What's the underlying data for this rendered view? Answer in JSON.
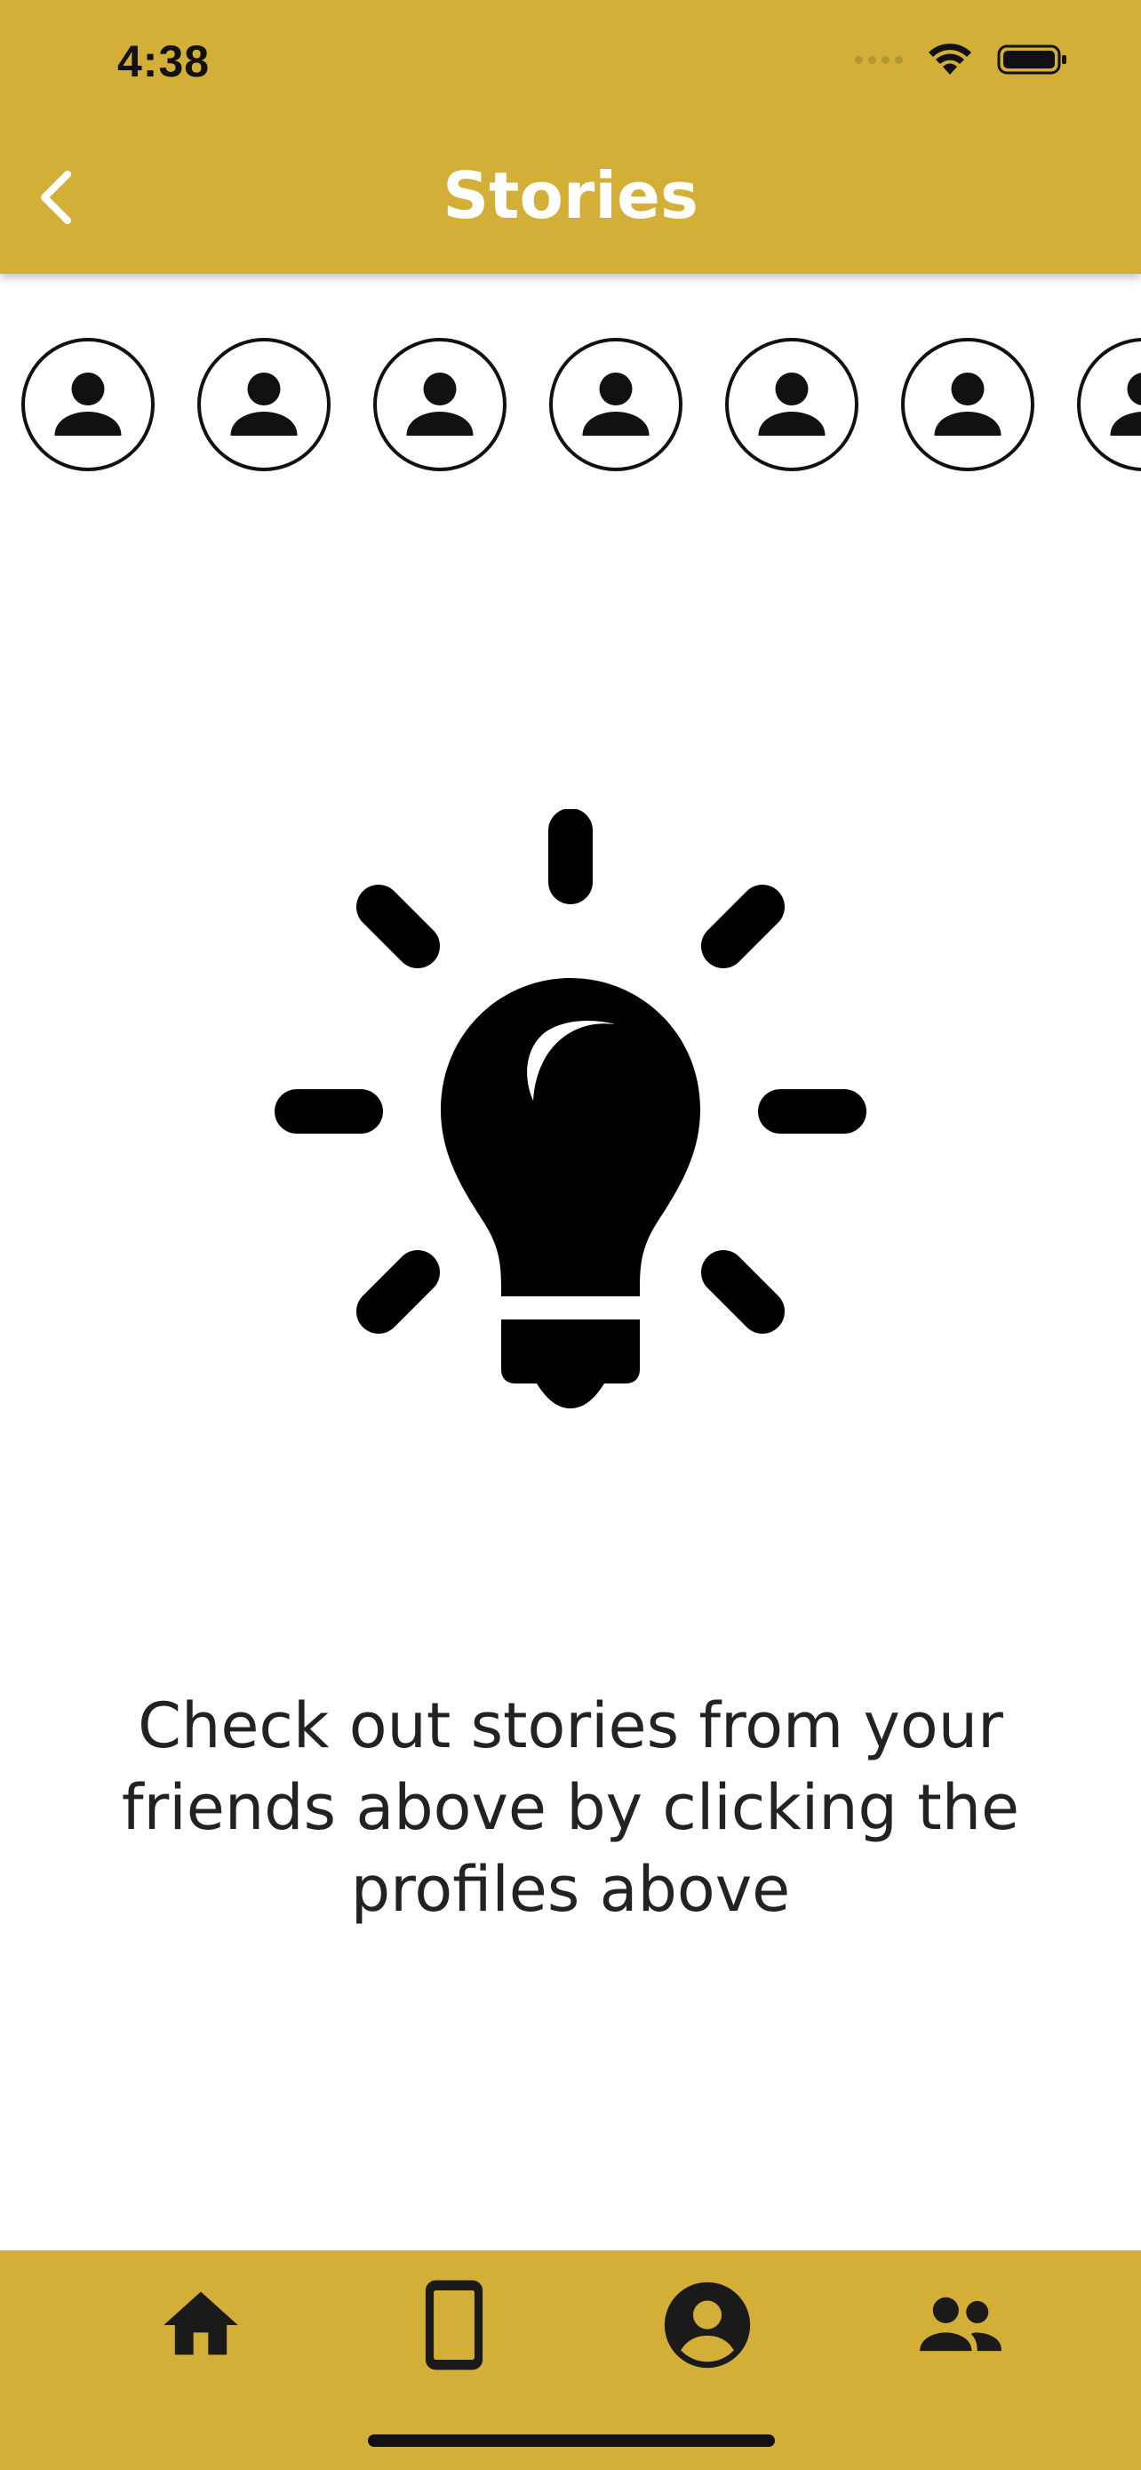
{
  "status_bar": {
    "time": "4:38"
  },
  "header": {
    "title": "Stories"
  },
  "stories": [
    {
      "icon": "person-icon"
    },
    {
      "icon": "person-icon"
    },
    {
      "icon": "person-icon"
    },
    {
      "icon": "person-icon"
    },
    {
      "icon": "person-icon"
    },
    {
      "icon": "person-icon"
    },
    {
      "icon": "person-icon"
    }
  ],
  "main": {
    "illustration": "lightbulb-icon",
    "message": "Check out stories from your friends above by clicking the profiles above"
  },
  "tab_bar": {
    "items": [
      {
        "icon": "home-icon"
      },
      {
        "icon": "phone-icon"
      },
      {
        "icon": "account-icon"
      },
      {
        "icon": "group-icon"
      }
    ]
  },
  "colors": {
    "accent": "#d4af37",
    "title": "#ffffff",
    "text": "#222222"
  }
}
